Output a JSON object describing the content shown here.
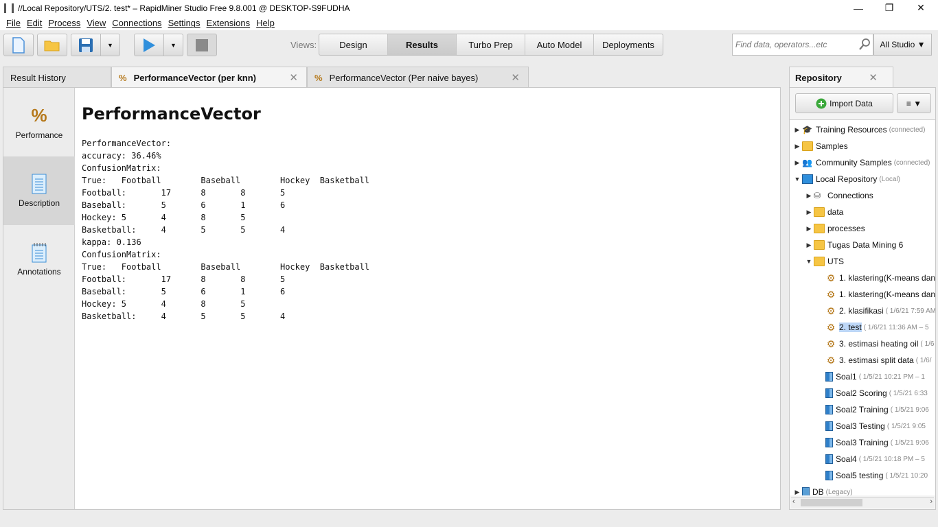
{
  "window": {
    "title": "//Local Repository/UTS/2. test* – RapidMiner Studio Free 9.8.001 @ DESKTOP-S9FUDHA",
    "minimize": "—",
    "restore": "❐",
    "close": "✕"
  },
  "menu": [
    "File",
    "Edit",
    "Process",
    "View",
    "Connections",
    "Settings",
    "Extensions",
    "Help"
  ],
  "toolbar": {
    "views_label": "Views:",
    "views": [
      "Design",
      "Results",
      "Turbo Prep",
      "Auto Model",
      "Deployments"
    ],
    "active_view": "Results",
    "search_placeholder": "Find data, operators...etc",
    "scope": "All Studio ▼"
  },
  "tabs": [
    {
      "label": "Result History",
      "icon": "",
      "active": false,
      "closable": false
    },
    {
      "label": "PerformanceVector (per knn)",
      "icon": "percent-icon",
      "active": true,
      "closable": true
    },
    {
      "label": "PerformanceVector (Per naive bayes)",
      "icon": "percent-icon",
      "active": false,
      "closable": true
    }
  ],
  "sidebar": [
    {
      "label": "Performance",
      "icon": "percent-icon",
      "active": false
    },
    {
      "label": "Description",
      "icon": "document-icon",
      "active": true
    },
    {
      "label": "Annotations",
      "icon": "notepad-icon",
      "active": false
    }
  ],
  "result": {
    "heading": "PerformanceVector",
    "text": "PerformanceVector:\naccuracy: 36.46%\nConfusionMatrix:\nTrue:   Football        Baseball        Hockey  Basketball\nFootball:       17      8       8       5\nBaseball:       5       6       1       6\nHockey: 5       4       8       5\nBasketball:     4       5       5       4\nkappa: 0.136\nConfusionMatrix:\nTrue:   Football        Baseball        Hockey  Basketball\nFootball:       17      8       8       5\nBaseball:       5       6       1       6\nHockey: 5       4       8       5\nBasketball:     4       5       5       4"
  },
  "repository": {
    "title": "Repository",
    "import_label": "Import Data",
    "menu_label": "≡ ▼",
    "items": [
      {
        "label": "Training Resources",
        "meta": "(connected)",
        "icon": "graduation-cap-icon",
        "level": 0,
        "arrow": "▶"
      },
      {
        "label": "Samples",
        "meta": "",
        "icon": "folder-icon",
        "level": 0,
        "arrow": "▶"
      },
      {
        "label": "Community Samples",
        "meta": "(connected)",
        "icon": "community-icon",
        "level": 0,
        "arrow": "▶"
      },
      {
        "label": "Local Repository",
        "meta": "(Local)",
        "icon": "monitor-icon",
        "level": 0,
        "arrow": "▼"
      },
      {
        "label": "Connections",
        "meta": "",
        "icon": "plug-icon",
        "level": 1,
        "arrow": "▶"
      },
      {
        "label": "data",
        "meta": "",
        "icon": "folder-icon",
        "level": 1,
        "arrow": "▶"
      },
      {
        "label": "processes",
        "meta": "",
        "icon": "folder-icon",
        "level": 1,
        "arrow": "▶"
      },
      {
        "label": "Tugas Data Mining 6",
        "meta": "",
        "icon": "folder-icon",
        "level": 1,
        "arrow": "▶"
      },
      {
        "label": "UTS",
        "meta": "",
        "icon": "folder-open-icon",
        "level": 1,
        "arrow": "▼"
      },
      {
        "label": "1. klastering(K-means dan",
        "meta": "",
        "icon": "process-gear-icon",
        "level": 2,
        "arrow": ""
      },
      {
        "label": "1. klastering(K-means dan",
        "meta": "",
        "icon": "process-gear-icon",
        "level": 2,
        "arrow": ""
      },
      {
        "label": "2. klasifikasi",
        "meta": "( 1/6/21 7:59 AM",
        "icon": "process-gear-icon",
        "level": 2,
        "arrow": ""
      },
      {
        "label": "2. test",
        "meta": "( 1/6/21 11:36 AM – 5",
        "icon": "process-gear-icon",
        "level": 2,
        "arrow": "",
        "selected": true
      },
      {
        "label": "3. estimasi heating oil",
        "meta": "( 1/6",
        "icon": "process-gear-icon",
        "level": 2,
        "arrow": ""
      },
      {
        "label": "3. estimasi split data",
        "meta": "( 1/6/",
        "icon": "process-gear-icon",
        "level": 2,
        "arrow": ""
      },
      {
        "label": "Soal1",
        "meta": "( 1/5/21 10:21 PM – 1",
        "icon": "data-table-icon",
        "level": 2,
        "arrow": ""
      },
      {
        "label": "Soal2 Scoring",
        "meta": "( 1/5/21 6:33",
        "icon": "data-table-icon",
        "level": 2,
        "arrow": ""
      },
      {
        "label": "Soal2 Training",
        "meta": "( 1/5/21 9:06",
        "icon": "data-table-icon",
        "level": 2,
        "arrow": ""
      },
      {
        "label": "Soal3 Testing",
        "meta": "( 1/5/21 9:05",
        "icon": "data-table-icon",
        "level": 2,
        "arrow": ""
      },
      {
        "label": "Soal3 Training",
        "meta": "( 1/5/21 9:06",
        "icon": "data-table-icon",
        "level": 2,
        "arrow": ""
      },
      {
        "label": "Soal4",
        "meta": "( 1/5/21 10:18 PM – 5",
        "icon": "data-table-icon",
        "level": 2,
        "arrow": ""
      },
      {
        "label": "Soal5 testing",
        "meta": "( 1/5/21 10:20",
        "icon": "data-table-icon",
        "level": 2,
        "arrow": ""
      },
      {
        "label": "DB",
        "meta": "(Legacy)",
        "icon": "database-icon",
        "level": 0,
        "arrow": "▶"
      }
    ]
  },
  "colors": {
    "accent_blue": "#2f8fdc",
    "selection": "#bdd7f7",
    "folder": "#f6c544",
    "import_green": "#3aa83a"
  }
}
